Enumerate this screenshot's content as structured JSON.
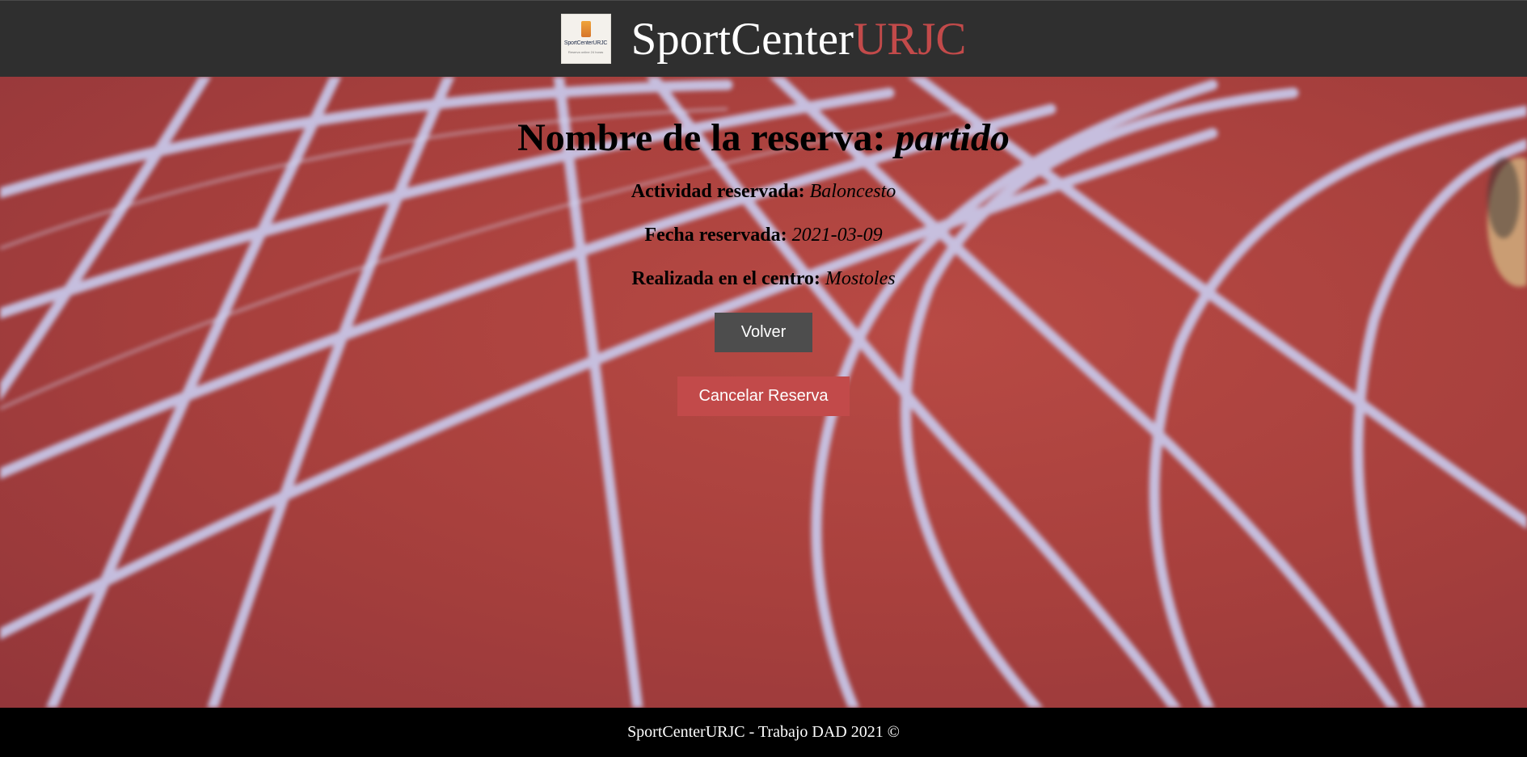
{
  "header": {
    "logo": {
      "text": "SportCenterURJC",
      "subtext": "Reserva online 24 horas"
    },
    "brand_main": "SportCenter",
    "brand_accent": "URJC"
  },
  "reservation": {
    "title_label": "Nombre de la reserva:",
    "title_value": "partido",
    "fields": [
      {
        "label": "Actividad reservada:",
        "value": "Baloncesto"
      },
      {
        "label": "Fecha reservada:",
        "value": "2021-03-09"
      },
      {
        "label": "Realizada en el centro:",
        "value": "Mostoles"
      }
    ]
  },
  "buttons": {
    "back_label": "Volver",
    "cancel_label": "Cancelar Reserva"
  },
  "footer": {
    "text": "SportCenterURJC - Trabajo DAD 2021 ©"
  },
  "colors": {
    "header_bg": "#2f2f2f",
    "accent": "#c24a4a",
    "back_button": "#4d4d4d",
    "footer_bg": "#000000"
  }
}
